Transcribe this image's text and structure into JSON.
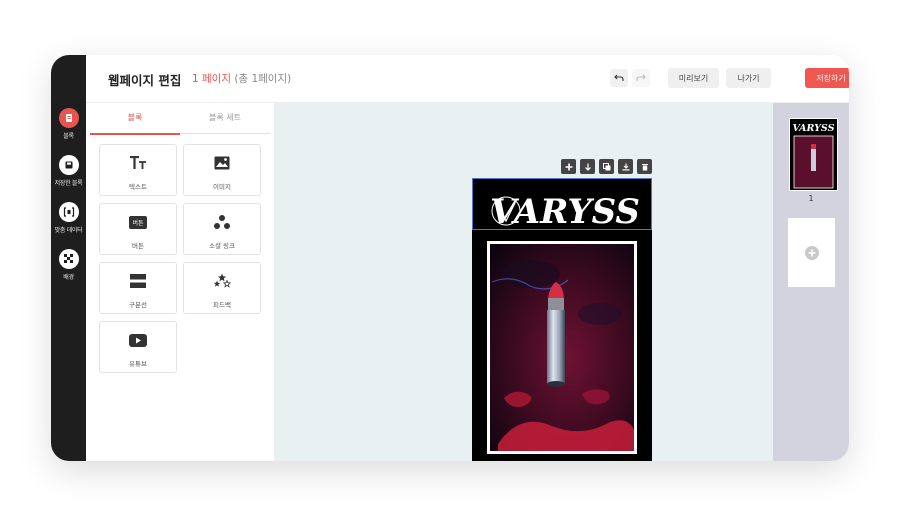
{
  "sidebar": {
    "items": [
      {
        "label": "블록",
        "icon": "block-icon",
        "active": true
      },
      {
        "label": "저장한 블록",
        "icon": "saved-block-icon",
        "active": false
      },
      {
        "label": "맞춤 데이터",
        "icon": "custom-data-icon",
        "active": false
      },
      {
        "label": "배경",
        "icon": "background-icon",
        "active": false
      }
    ]
  },
  "header": {
    "title": "웹페이지 편집",
    "current_page": "1 페이지",
    "total_pages": "(총 1페이지)",
    "undo_icon": "undo-icon",
    "redo_icon": "redo-icon",
    "preview_label": "미리보기",
    "exit_label": "나가기",
    "save_label": "저장하기"
  },
  "panel": {
    "tabs": [
      {
        "label": "블록",
        "active": true
      },
      {
        "label": "블록 세트",
        "active": false
      }
    ],
    "blocks": [
      {
        "label": "텍스트",
        "icon": "text-icon"
      },
      {
        "label": "이미지",
        "icon": "image-icon"
      },
      {
        "label": "버튼",
        "icon": "button-icon",
        "icon_text": "버튼"
      },
      {
        "label": "소셜 링크",
        "icon": "social-link-icon"
      },
      {
        "label": "구분선",
        "icon": "divider-icon"
      },
      {
        "label": "피드백",
        "icon": "feedback-icon"
      },
      {
        "label": "유튜브",
        "icon": "youtube-icon"
      }
    ]
  },
  "canvas": {
    "toolbar": [
      {
        "action": "add",
        "icon": "plus-icon"
      },
      {
        "action": "move-down",
        "icon": "arrow-down-icon"
      },
      {
        "action": "duplicate",
        "icon": "copy-icon"
      },
      {
        "action": "save-block",
        "icon": "download-icon"
      },
      {
        "action": "delete",
        "icon": "trash-icon"
      }
    ],
    "poster": {
      "brand": "VARYSS",
      "image": "lipstick-photo"
    }
  },
  "pages": {
    "thumbnails": [
      {
        "number": "1",
        "brand": "VARYSS"
      }
    ],
    "add_icon": "add-page-icon"
  },
  "colors": {
    "accent": "#e8544f",
    "save_button": "#ef5750",
    "sidebar_bg": "#1e1e1e",
    "canvas_bg": "#e9f0f1",
    "pages_bg": "#d3d3e0"
  }
}
